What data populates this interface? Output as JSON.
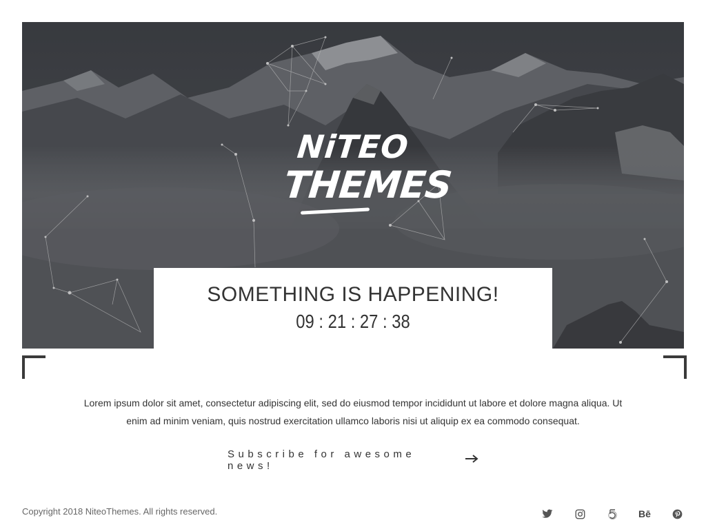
{
  "hero": {
    "logo": {
      "line1": "NiTEO",
      "line2": "THEMES"
    }
  },
  "card": {
    "title": "SOMETHING IS HAPPENING!",
    "countdown": "09 : 21 : 27 : 38"
  },
  "description": "Lorem ipsum dolor sit amet, consectetur adipiscing elit, sed do eiusmod tempor incididunt ut labore et dolore magna aliqua. Ut enim ad minim veniam, quis nostrud exercitation ullamco laboris nisi ut aliquip ex ea commodo consequat.",
  "subscribe": {
    "label": "Subscribe for awesome news!",
    "icon": "arrow-right-icon"
  },
  "footer": {
    "copyright": "Copyright 2018 NiteoThemes. All rights reserved.",
    "social": [
      {
        "name": "twitter-icon"
      },
      {
        "name": "instagram-icon"
      },
      {
        "name": "500px-icon"
      },
      {
        "name": "behance-icon",
        "label": "Bē"
      },
      {
        "name": "pinterest-icon"
      }
    ]
  },
  "colors": {
    "text": "#333333",
    "accent": "#3a3a3a",
    "hero_overlay": "#45484d"
  }
}
